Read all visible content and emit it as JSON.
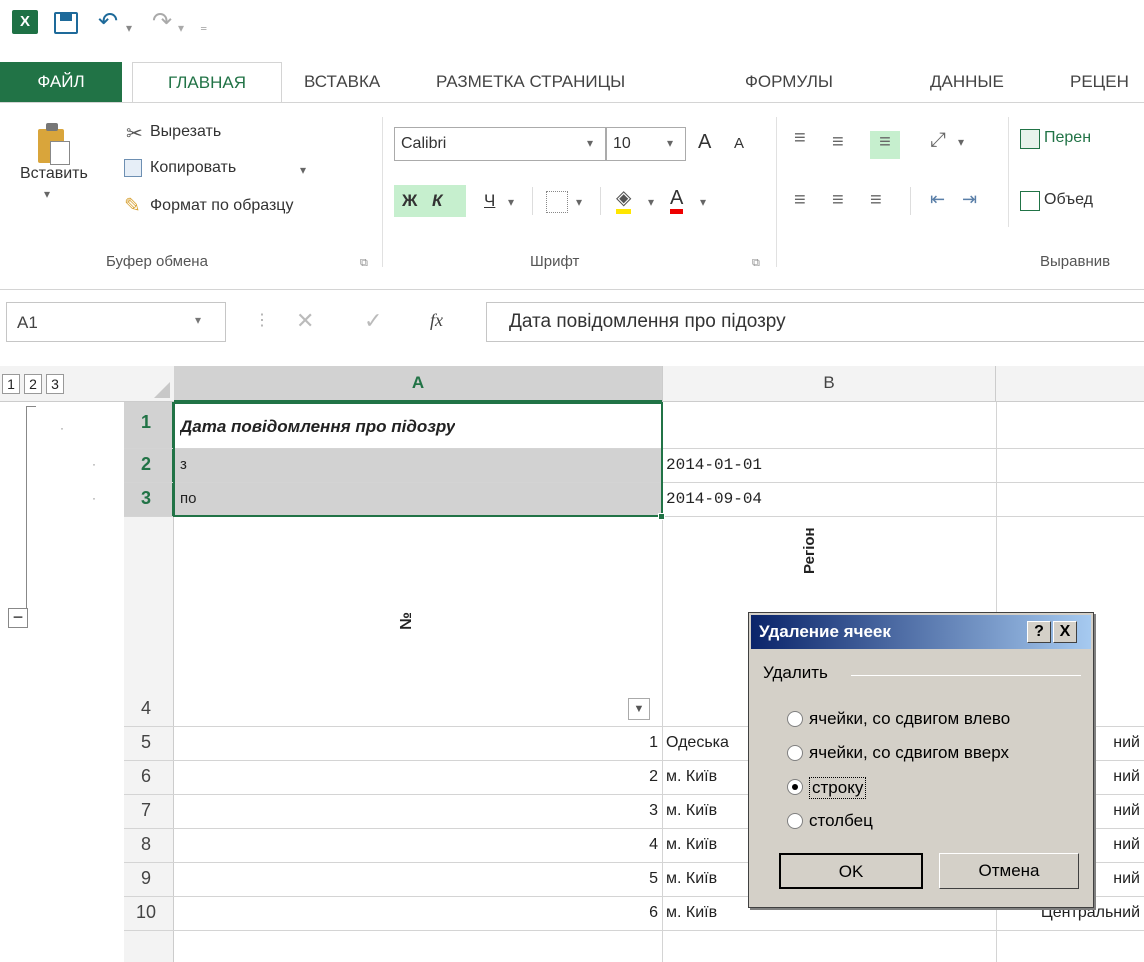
{
  "qat": {
    "excel_icon": "X",
    "save_icon": "save-icon",
    "undo_icon": "undo-icon",
    "redo_icon": "redo-icon"
  },
  "tabs": [
    "ФАЙЛ",
    "ГЛАВНАЯ",
    "ВСТАВКА",
    "РАЗМЕТКА СТРАНИЦЫ",
    "ФОРМУЛЫ",
    "ДАННЫЕ",
    "РЕЦЕН"
  ],
  "clipboard": {
    "paste": "Вставить",
    "cut": "Вырезать",
    "copy": "Копировать",
    "format_painter": "Формат по образцу",
    "group": "Буфер обмена"
  },
  "font": {
    "name": "Calibri",
    "size": "10",
    "bold": "Ж",
    "italic": "К",
    "underline": "Ч",
    "grow": "A",
    "shrink": "A",
    "font_color": "A",
    "group": "Шрифт"
  },
  "alignment": {
    "wrap": "Перен",
    "merge": "Объед",
    "group": "Выравнив"
  },
  "formula_bar": {
    "name_box": "A1",
    "fx": "fx",
    "content": "Дата повідомлення про підозру"
  },
  "outline_levels": [
    "1",
    "2",
    "3"
  ],
  "columns": [
    "A",
    "B"
  ],
  "rows": [
    {
      "num": "1",
      "a": "Дата повідомлення про підозру",
      "a_right": "",
      "b": "",
      "c": ""
    },
    {
      "num": "2",
      "a": "з",
      "a_right": "",
      "b": "2014-01-01",
      "c": ""
    },
    {
      "num": "3",
      "a": "по",
      "a_right": "",
      "b": "2014-09-04",
      "c": ""
    },
    {
      "num": "4",
      "a": "№",
      "a_right": "",
      "b": "Регіон",
      "c": ""
    },
    {
      "num": "5",
      "a": "",
      "a_right": "1",
      "b": "Одеська",
      "c": "ний"
    },
    {
      "num": "6",
      "a": "",
      "a_right": "2",
      "b": "м. Київ",
      "c": "ний"
    },
    {
      "num": "7",
      "a": "",
      "a_right": "3",
      "b": "м. Київ",
      "c": "ний"
    },
    {
      "num": "8",
      "a": "",
      "a_right": "4",
      "b": "м. Київ",
      "c": "ний"
    },
    {
      "num": "9",
      "a": "",
      "a_right": "5",
      "b": "м. Київ",
      "c": "ний"
    },
    {
      "num": "10",
      "a": "",
      "a_right": "6",
      "b": "м. Київ",
      "c": "Центральний"
    }
  ],
  "dialog": {
    "title": "Удаление ячеек",
    "help": "?",
    "close": "X",
    "group": "Удалить",
    "options": [
      "ячейки, со сдвигом влево",
      "ячейки, со сдвигом вверх",
      "строку",
      "столбец"
    ],
    "selected": "строку",
    "ok": "OK",
    "cancel": "Отмена"
  },
  "colors": {
    "accent": "#217346",
    "selection": "#217346"
  }
}
